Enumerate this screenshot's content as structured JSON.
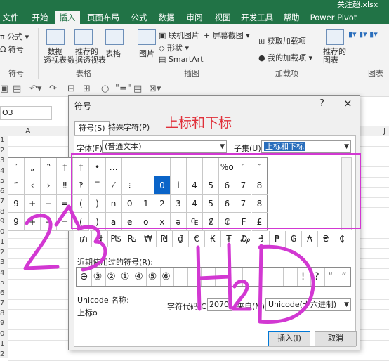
{
  "window": {
    "title": "关注超.xlsx"
  },
  "ribbon": {
    "tabs": [
      "文件",
      "开始",
      "插入",
      "页面布局",
      "公式",
      "数据",
      "审阅",
      "视图",
      "开发工具",
      "帮助",
      "Power Pivot"
    ],
    "active_tab": "插入",
    "formula_items": [
      "公式",
      "符号"
    ],
    "formula_group_label": "符号",
    "pivot_label1": "数据\n透视表",
    "pivot_label2": "推荐的\n数据透视表",
    "table_label": "表格",
    "tables_group_label": "表格",
    "picture_label": "图片",
    "online_picture": "联机图片",
    "shapes": "形状",
    "smartart": "SmartArt",
    "screenshot": "屏幕截图",
    "illustrations_group_label": "插图",
    "get_addins": "获取加载项",
    "my_addins": "我的加载项",
    "addins_group_label": "加载项",
    "rec_charts": "推荐的\n图表",
    "charts_group_label": "图表"
  },
  "formula_bar": {
    "name_box": "O3"
  },
  "grid": {
    "columns": [
      "A",
      "J"
    ],
    "rows": [
      "1",
      "2",
      "3",
      "4",
      "5",
      "6",
      "7",
      "8",
      "9",
      "0",
      "1",
      "2",
      "3",
      "4",
      "5",
      "6",
      "7",
      "8",
      "9",
      "0",
      "1",
      "2"
    ]
  },
  "dialog": {
    "title": "符号",
    "help": "?",
    "close": "×",
    "annotation": "上标和下标",
    "tab_symbols": "符号(S)",
    "tab_special": "特殊字符(P)",
    "font_label": "字体(F):",
    "font_value": "(普通文本)",
    "subset_label": "子集(U):",
    "subset_value": "上标和下标",
    "symbols": [
      [
        "″",
        "„",
        "‟",
        "†",
        "‡",
        "•",
        "…",
        "",
        "",
        "",
        "",
        "",
        "",
        "%o",
        "′",
        "″"
      ],
      [
        "‴",
        "‹",
        "›",
        "‼",
        "‽",
        "‾",
        "⁄",
        "⁝",
        "",
        "0",
        "i",
        "4",
        "5",
        "6",
        "7",
        "8"
      ],
      [
        "9",
        "+",
        "−",
        "=",
        "(",
        ")",
        "n",
        "0",
        "1",
        "2",
        "3",
        "4",
        "5",
        "6",
        "7",
        "8"
      ],
      [
        "9",
        "+",
        "−",
        "=",
        "(",
        ")",
        "a",
        "e",
        "o",
        "x",
        "ə",
        "₠",
        "₡",
        "₢",
        "₣",
        "₤"
      ]
    ],
    "selected_symbol": "0",
    "extra_row": [
      "₥",
      "₦",
      "₧",
      "₨",
      "₩",
      "₪",
      "₫",
      "€",
      "₭",
      "₮",
      "₯",
      "₰",
      "₱",
      "₲",
      "₳",
      "₴",
      "₵"
    ],
    "recent_label": "近期使用过的符号(R):",
    "recent_symbols": [
      "⊕",
      "③",
      "②",
      "①",
      "④",
      "⑤",
      "⑥",
      "",
      "",
      "",
      "",
      "",
      "",
      "",
      "",
      "",
      "!",
      "?",
      "“",
      "”"
    ],
    "unicode_name_label": "Unicode 名称:",
    "unicode_name_value": "上标o",
    "char_code_label": "字符代码(C):",
    "char_code_value": "2070",
    "from_label": "来自(M):",
    "from_value": "Unicode(十六进制)",
    "insert_button": "插入(I)",
    "cancel_button": "取消"
  },
  "handwriting": {
    "left": "2^3",
    "right": "H2O"
  },
  "colors": {
    "excel_green": "#217346",
    "annotation_red": "#e0303a",
    "magenta": "#d238d2",
    "selected_blue": "#0a64c8"
  }
}
